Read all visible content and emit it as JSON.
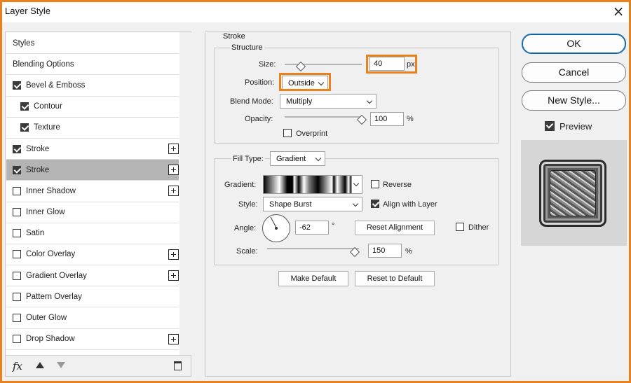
{
  "window": {
    "title": "Layer Style"
  },
  "styles_list": [
    {
      "label": "Styles",
      "checkbox": false,
      "checked": false,
      "plus": false,
      "selected": false,
      "indent": false
    },
    {
      "label": "Blending Options",
      "checkbox": false,
      "checked": false,
      "plus": false,
      "selected": false,
      "indent": false
    },
    {
      "label": "Bevel & Emboss",
      "checkbox": true,
      "checked": true,
      "plus": false,
      "selected": false,
      "indent": false
    },
    {
      "label": "Contour",
      "checkbox": true,
      "checked": true,
      "plus": false,
      "selected": false,
      "indent": true
    },
    {
      "label": "Texture",
      "checkbox": true,
      "checked": true,
      "plus": false,
      "selected": false,
      "indent": true
    },
    {
      "label": "Stroke",
      "checkbox": true,
      "checked": true,
      "plus": true,
      "selected": false,
      "indent": false
    },
    {
      "label": "Stroke",
      "checkbox": true,
      "checked": true,
      "plus": true,
      "selected": true,
      "indent": false
    },
    {
      "label": "Inner Shadow",
      "checkbox": true,
      "checked": false,
      "plus": true,
      "selected": false,
      "indent": false
    },
    {
      "label": "Inner Glow",
      "checkbox": true,
      "checked": false,
      "plus": false,
      "selected": false,
      "indent": false
    },
    {
      "label": "Satin",
      "checkbox": true,
      "checked": false,
      "plus": false,
      "selected": false,
      "indent": false
    },
    {
      "label": "Color Overlay",
      "checkbox": true,
      "checked": false,
      "plus": true,
      "selected": false,
      "indent": false
    },
    {
      "label": "Gradient Overlay",
      "checkbox": true,
      "checked": false,
      "plus": true,
      "selected": false,
      "indent": false
    },
    {
      "label": "Pattern Overlay",
      "checkbox": true,
      "checked": false,
      "plus": false,
      "selected": false,
      "indent": false
    },
    {
      "label": "Outer Glow",
      "checkbox": true,
      "checked": false,
      "plus": false,
      "selected": false,
      "indent": false
    },
    {
      "label": "Drop Shadow",
      "checkbox": true,
      "checked": false,
      "plus": true,
      "selected": false,
      "indent": false
    }
  ],
  "bottom_bar": {
    "fx_label": "fx"
  },
  "stroke": {
    "section_title": "Stroke",
    "structure_title": "Structure",
    "size_label": "Size:",
    "size_value": "40",
    "size_unit": "px",
    "position_label": "Position:",
    "position_value": "Outside",
    "blend_mode_label": "Blend Mode:",
    "blend_mode_value": "Multiply",
    "opacity_label": "Opacity:",
    "opacity_value": "100",
    "opacity_unit": "%",
    "overprint_label": "Overprint",
    "overprint_checked": false
  },
  "fill": {
    "fill_type_label": "Fill Type:",
    "fill_type_value": "Gradient",
    "gradient_label": "Gradient:",
    "reverse_label": "Reverse",
    "reverse_checked": false,
    "style_label": "Style:",
    "style_value": "Shape Burst",
    "align_label": "Align with Layer",
    "align_checked": true,
    "angle_label": "Angle:",
    "angle_value": "-62",
    "angle_unit": "°",
    "reset_alignment_label": "Reset Alignment",
    "dither_label": "Dither",
    "dither_checked": false,
    "scale_label": "Scale:",
    "scale_value": "150",
    "scale_unit": "%"
  },
  "defaults": {
    "make_default_label": "Make Default",
    "reset_default_label": "Reset to Default"
  },
  "right_panel": {
    "ok_label": "OK",
    "cancel_label": "Cancel",
    "new_style_label": "New Style...",
    "preview_label": "Preview",
    "preview_checked": true
  },
  "colors": {
    "highlight": "#e8821e",
    "selected_row": "#b4b4b4",
    "ok_border": "#0a64ad"
  }
}
